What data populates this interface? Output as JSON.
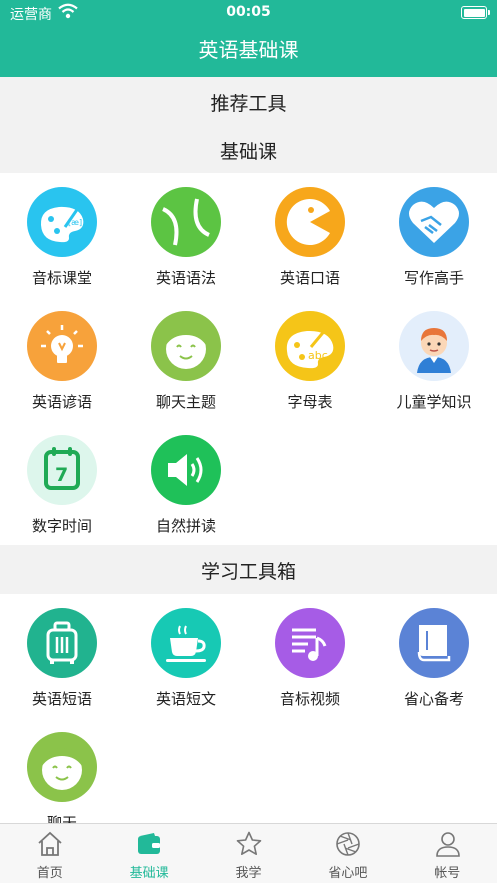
{
  "status_bar": {
    "carrier": "运营商",
    "time": "00:05"
  },
  "nav": {
    "title": "英语基础课"
  },
  "sections": {
    "recommend": "推荐工具",
    "basic": "基础课",
    "toolbox": "学习工具箱"
  },
  "basic_items": [
    {
      "label": "音标课堂",
      "icon": "palette-phonetic-icon",
      "color": "#29c4ef"
    },
    {
      "label": "英语语法",
      "icon": "tennis-ball-icon",
      "color": "#5cc443"
    },
    {
      "label": "英语口语",
      "icon": "pacman-icon",
      "color": "#f7a71b"
    },
    {
      "label": "写作高手",
      "icon": "handshake-heart-icon",
      "color": "#3ba3e6"
    },
    {
      "label": "英语谚语",
      "icon": "lightbulb-icon",
      "color": "#f7a23b"
    },
    {
      "label": "聊天主题",
      "icon": "smiley-face-icon",
      "color": "#8bc34a"
    },
    {
      "label": "字母表",
      "icon": "palette-abc-icon",
      "color": "#f5c518"
    },
    {
      "label": "儿童学知识",
      "icon": "child-avatar-icon",
      "color": "#e3eefb"
    },
    {
      "label": "数字时间",
      "icon": "calendar-seven-icon",
      "color": "#ddf6ec"
    },
    {
      "label": "自然拼读",
      "icon": "speaker-icon",
      "color": "#1fc159"
    }
  ],
  "toolbox_items": [
    {
      "label": "英语短语",
      "icon": "suitcase-icon",
      "color": "#21b38f"
    },
    {
      "label": "英语短文",
      "icon": "coffee-cup-icon",
      "color": "#17c9b4"
    },
    {
      "label": "音标视频",
      "icon": "music-list-icon",
      "color": "#a65ce6"
    },
    {
      "label": "省心备考",
      "icon": "book-icon",
      "color": "#5b83d6"
    },
    {
      "label": "聊天",
      "icon": "smiley-face-icon",
      "color": "#8bc34a"
    }
  ],
  "tabbar": {
    "active_color": "#22b999",
    "items": [
      {
        "label": "首页",
        "icon": "home-icon"
      },
      {
        "label": "基础课",
        "icon": "wallet-icon"
      },
      {
        "label": "我学",
        "icon": "star-icon"
      },
      {
        "label": "省心吧",
        "icon": "aperture-icon"
      },
      {
        "label": "帐号",
        "icon": "person-icon"
      }
    ]
  },
  "colors": {
    "brand": "#22b999"
  }
}
